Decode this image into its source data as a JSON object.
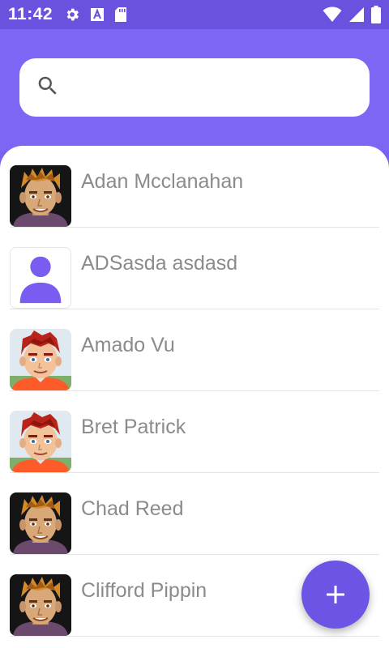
{
  "status_bar": {
    "time": "11:42",
    "left_icons": [
      "gear-icon",
      "font-a-icon",
      "sd-card-icon"
    ],
    "right_icons": [
      "wifi-icon",
      "cellular-signal-icon",
      "battery-icon"
    ]
  },
  "search": {
    "icon": "search-icon",
    "value": "",
    "placeholder": ""
  },
  "contacts": [
    {
      "name": "Adan Mcclanahan",
      "avatar": "cartoon-man-blond-hair"
    },
    {
      "name": "ADSasda asdasd",
      "avatar": "default-person-placeholder"
    },
    {
      "name": "Amado Vu",
      "avatar": "cartoon-man-red-hair"
    },
    {
      "name": "Bret Patrick",
      "avatar": "cartoon-man-red-hair"
    },
    {
      "name": "Chad Reed",
      "avatar": "cartoon-man-blond-hair"
    },
    {
      "name": "Clifford Pippin",
      "avatar": "cartoon-man-blond-hair"
    }
  ],
  "fab": {
    "icon": "plus-icon"
  },
  "colors": {
    "primary": "#7d66f4",
    "status_bar": "#6a51de",
    "fab": "#6d54e4",
    "name_text": "#8b8b8b",
    "placeholder_avatar": "#7a5cf0"
  }
}
